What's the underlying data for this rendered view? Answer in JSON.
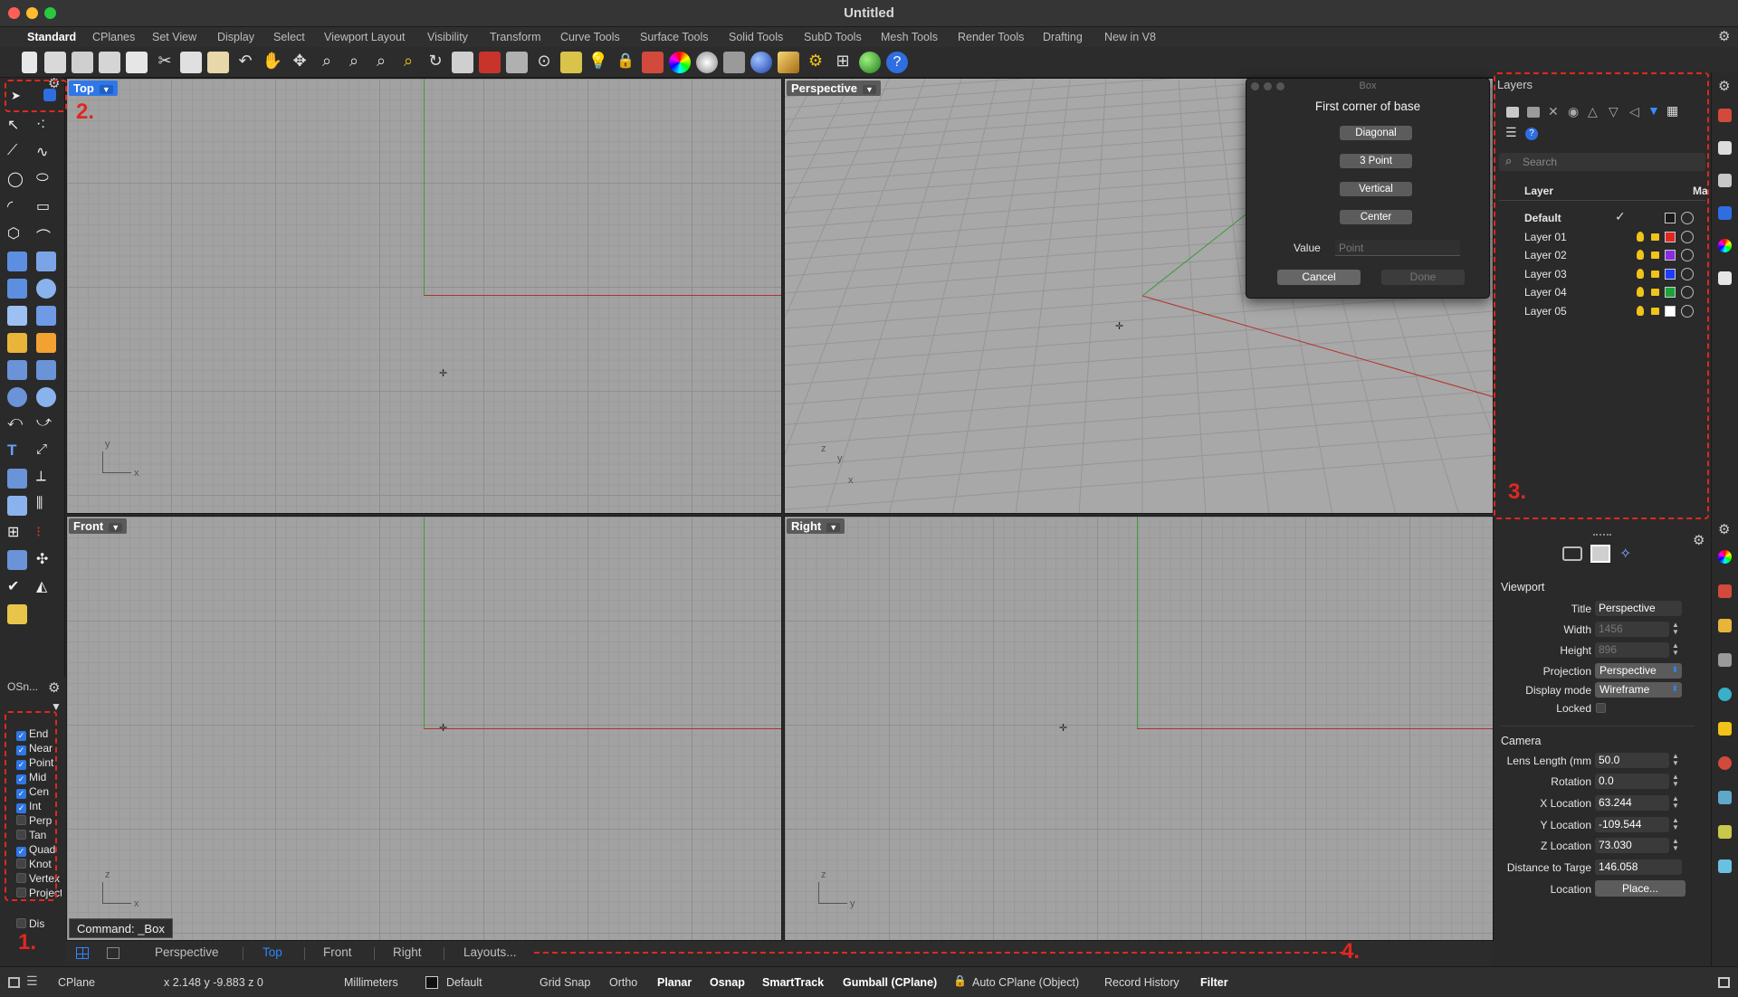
{
  "window": {
    "title": "Untitled"
  },
  "menu_tabs": [
    "Standard",
    "CPlanes",
    "Set View",
    "Display",
    "Select",
    "Viewport Layout",
    "Visibility",
    "Transform",
    "Curve Tools",
    "Surface Tools",
    "Solid Tools",
    "SubD Tools",
    "Mesh Tools",
    "Render Tools",
    "Drafting",
    "New in V8"
  ],
  "viewports": {
    "top": {
      "label": "Top"
    },
    "perspective": {
      "label": "Perspective"
    },
    "front": {
      "label": "Front"
    },
    "right": {
      "label": "Right"
    }
  },
  "axis_labels": {
    "x": "x",
    "y": "y",
    "z": "z"
  },
  "box_dialog": {
    "window_title": "Box",
    "prompt": "First corner of base",
    "options": [
      "Diagonal",
      "3 Point",
      "Vertical",
      "Center"
    ],
    "value_label": "Value",
    "value_placeholder": "Point",
    "cancel": "Cancel",
    "done": "Done"
  },
  "layers_panel": {
    "title": "Layers",
    "search_placeholder": "Search",
    "col_layer": "Layer",
    "col_material": "Ma",
    "rows": [
      {
        "name": "Default",
        "color": "#1a1a1a",
        "current": true
      },
      {
        "name": "Layer 01",
        "color": "#e0281f"
      },
      {
        "name": "Layer 02",
        "color": "#8a2be2"
      },
      {
        "name": "Layer 03",
        "color": "#1e3cff"
      },
      {
        "name": "Layer 04",
        "color": "#1aa33a"
      },
      {
        "name": "Layer 05",
        "color": "#ffffff"
      }
    ]
  },
  "properties": {
    "section_viewport": "Viewport",
    "title_label": "Title",
    "title_value": "Perspective",
    "width_label": "Width",
    "width_value": "1456",
    "height_label": "Height",
    "height_value": "896",
    "projection_label": "Projection",
    "projection_value": "Perspective",
    "display_label": "Display mode",
    "display_value": "Wireframe",
    "locked_label": "Locked",
    "section_camera": "Camera",
    "lens_label": "Lens Length (mm",
    "lens_value": "50.0",
    "rotation_label": "Rotation",
    "rotation_value": "0.0",
    "xloc_label": "X Location",
    "xloc_value": "63.244",
    "yloc_label": "Y Location",
    "yloc_value": "-109.544",
    "zloc_label": "Z Location",
    "zloc_value": "73.030",
    "dist_label": "Distance to Targe",
    "dist_value": "146.058",
    "location_label": "Location",
    "place_button": "Place..."
  },
  "osnap": {
    "title": "OSn...",
    "items": [
      {
        "label": "End",
        "on": true
      },
      {
        "label": "Near",
        "on": true
      },
      {
        "label": "Point",
        "on": true
      },
      {
        "label": "Mid",
        "on": true
      },
      {
        "label": "Cen",
        "on": true
      },
      {
        "label": "Int",
        "on": true
      },
      {
        "label": "Perp",
        "on": false
      },
      {
        "label": "Tan",
        "on": false
      },
      {
        "label": "Quad",
        "on": true
      },
      {
        "label": "Knot",
        "on": false
      },
      {
        "label": "Vertex",
        "on": false
      },
      {
        "label": "Project",
        "on": false
      }
    ],
    "disable": "Dis"
  },
  "command": "Command: _Box",
  "viewport_tabs": [
    "Perspective",
    "Top",
    "Front",
    "Right",
    "Layouts..."
  ],
  "active_viewport_tab": "Top",
  "status": {
    "cplane": "CPlane",
    "coords": "x 2.148  y -9.883  z 0",
    "units": "Millimeters",
    "layer": "Default",
    "grid_snap": "Grid Snap",
    "ortho": "Ortho",
    "planar": "Planar",
    "osnap": "Osnap",
    "smarttrack": "SmartTrack",
    "gumball": "Gumball (CPlane)",
    "auto_cplane": "Auto CPlane (Object)",
    "record_history": "Record History",
    "filter": "Filter"
  },
  "annotations": [
    "1.",
    "2.",
    "3.",
    "4."
  ]
}
